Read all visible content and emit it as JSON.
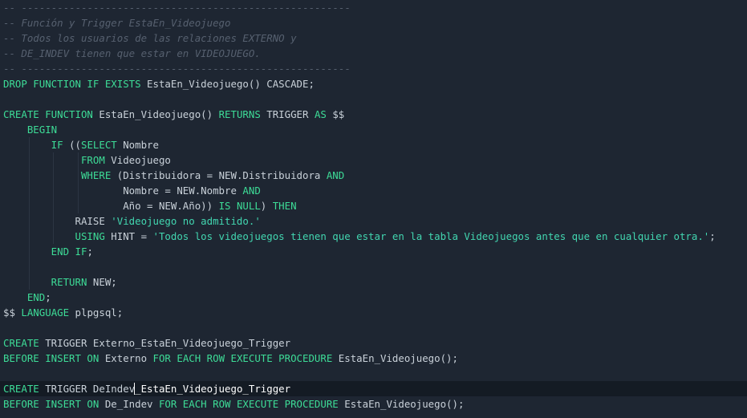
{
  "theme": {
    "background": "#1e2632",
    "keyword": "#3ddc97",
    "identifier": "#c9d1d9",
    "string": "#42d6b0",
    "comment": "#56606f",
    "current_line": "#141b24"
  },
  "editor": {
    "language": "sql",
    "cursor_line": 25,
    "lines": [
      [
        {
          "t": "-- -------------------------------------------------------",
          "c": "sep"
        }
      ],
      [
        {
          "t": "-- Función y Trigger EstaEn_Videojuego",
          "c": "cm"
        }
      ],
      [
        {
          "t": "-- Todos los usuarios de las relaciones EXTERNO y",
          "c": "cm"
        }
      ],
      [
        {
          "t": "-- DE_INDEV tienen que estar en VIDEOJUEGO.",
          "c": "cm"
        }
      ],
      [
        {
          "t": "-- -------------------------------------------------------",
          "c": "sep"
        }
      ],
      [
        {
          "t": "DROP FUNCTION IF EXISTS ",
          "c": "kw"
        },
        {
          "t": "EstaEn_Videojuego() CASCADE;",
          "c": "id"
        }
      ],
      [],
      [
        {
          "t": "CREATE FUNCTION ",
          "c": "kw"
        },
        {
          "t": "EstaEn_Videojuego() ",
          "c": "id"
        },
        {
          "t": "RETURNS ",
          "c": "kw"
        },
        {
          "t": "TRIGGER ",
          "c": "id"
        },
        {
          "t": "AS ",
          "c": "kw"
        },
        {
          "t": "$$",
          "c": "id"
        }
      ],
      [
        {
          "t": "    BEGIN",
          "c": "kw"
        }
      ],
      [
        {
          "t": "        IF ",
          "c": "kw"
        },
        {
          "t": "((",
          "c": "id"
        },
        {
          "t": "SELECT ",
          "c": "kw"
        },
        {
          "t": "Nombre",
          "c": "id"
        }
      ],
      [
        {
          "t": "             FROM ",
          "c": "kw"
        },
        {
          "t": "Videojuego",
          "c": "id"
        }
      ],
      [
        {
          "t": "             WHERE ",
          "c": "kw"
        },
        {
          "t": "(Distribuidora = NEW.Distribuidora ",
          "c": "id"
        },
        {
          "t": "AND",
          "c": "kw"
        }
      ],
      [
        {
          "t": "                    Nombre = NEW.Nombre ",
          "c": "id"
        },
        {
          "t": "AND",
          "c": "kw"
        }
      ],
      [
        {
          "t": "                    Año = NEW.Año)) ",
          "c": "id"
        },
        {
          "t": "IS NULL",
          "c": "kw"
        },
        {
          "t": ") ",
          "c": "id"
        },
        {
          "t": "THEN",
          "c": "kw"
        }
      ],
      [
        {
          "t": "            RAISE ",
          "c": "id"
        },
        {
          "t": "'Videojuego no admitido.'",
          "c": "str"
        }
      ],
      [
        {
          "t": "            USING ",
          "c": "kw"
        },
        {
          "t": "HINT = ",
          "c": "id"
        },
        {
          "t": "'Todos los videojuegos tienen que estar en la tabla Videojuegos antes que en cualquier otra.'",
          "c": "str"
        },
        {
          "t": ";",
          "c": "id"
        }
      ],
      [
        {
          "t": "        END IF",
          "c": "kw"
        },
        {
          "t": ";",
          "c": "id"
        }
      ],
      [],
      [
        {
          "t": "        RETURN ",
          "c": "kw"
        },
        {
          "t": "NEW;",
          "c": "id"
        }
      ],
      [
        {
          "t": "    END",
          "c": "kw"
        },
        {
          "t": ";",
          "c": "id"
        }
      ],
      [
        {
          "t": "$$ ",
          "c": "id"
        },
        {
          "t": "LANGUAGE ",
          "c": "kw"
        },
        {
          "t": "plpgsql;",
          "c": "id"
        }
      ],
      [],
      [
        {
          "t": "CREATE ",
          "c": "kw"
        },
        {
          "t": "TRIGGER ",
          "c": "id"
        },
        {
          "t": "Externo_EstaEn_Videojuego_Trigger",
          "c": "id"
        }
      ],
      [
        {
          "t": "BEFORE INSERT ON ",
          "c": "kw"
        },
        {
          "t": "Externo ",
          "c": "id"
        },
        {
          "t": "FOR EACH ROW EXECUTE PROCEDURE ",
          "c": "kw"
        },
        {
          "t": "EstaEn_Videojuego();",
          "c": "id"
        }
      ],
      [],
      [
        {
          "t": "CREATE ",
          "c": "kw"
        },
        {
          "t": "TRIGGER ",
          "c": "id"
        },
        {
          "t": "DeIndev",
          "c": "id"
        },
        {
          "t": "_EstaEn_Videojuego_Trigger",
          "c": "cur"
        }
      ],
      [
        {
          "t": "BEFORE INSERT ON ",
          "c": "kw"
        },
        {
          "t": "De_Indev ",
          "c": "id"
        },
        {
          "t": "FOR EACH ROW EXECUTE PROCEDURE ",
          "c": "kw"
        },
        {
          "t": "EstaEn_Videojuego();",
          "c": "id"
        }
      ]
    ]
  }
}
